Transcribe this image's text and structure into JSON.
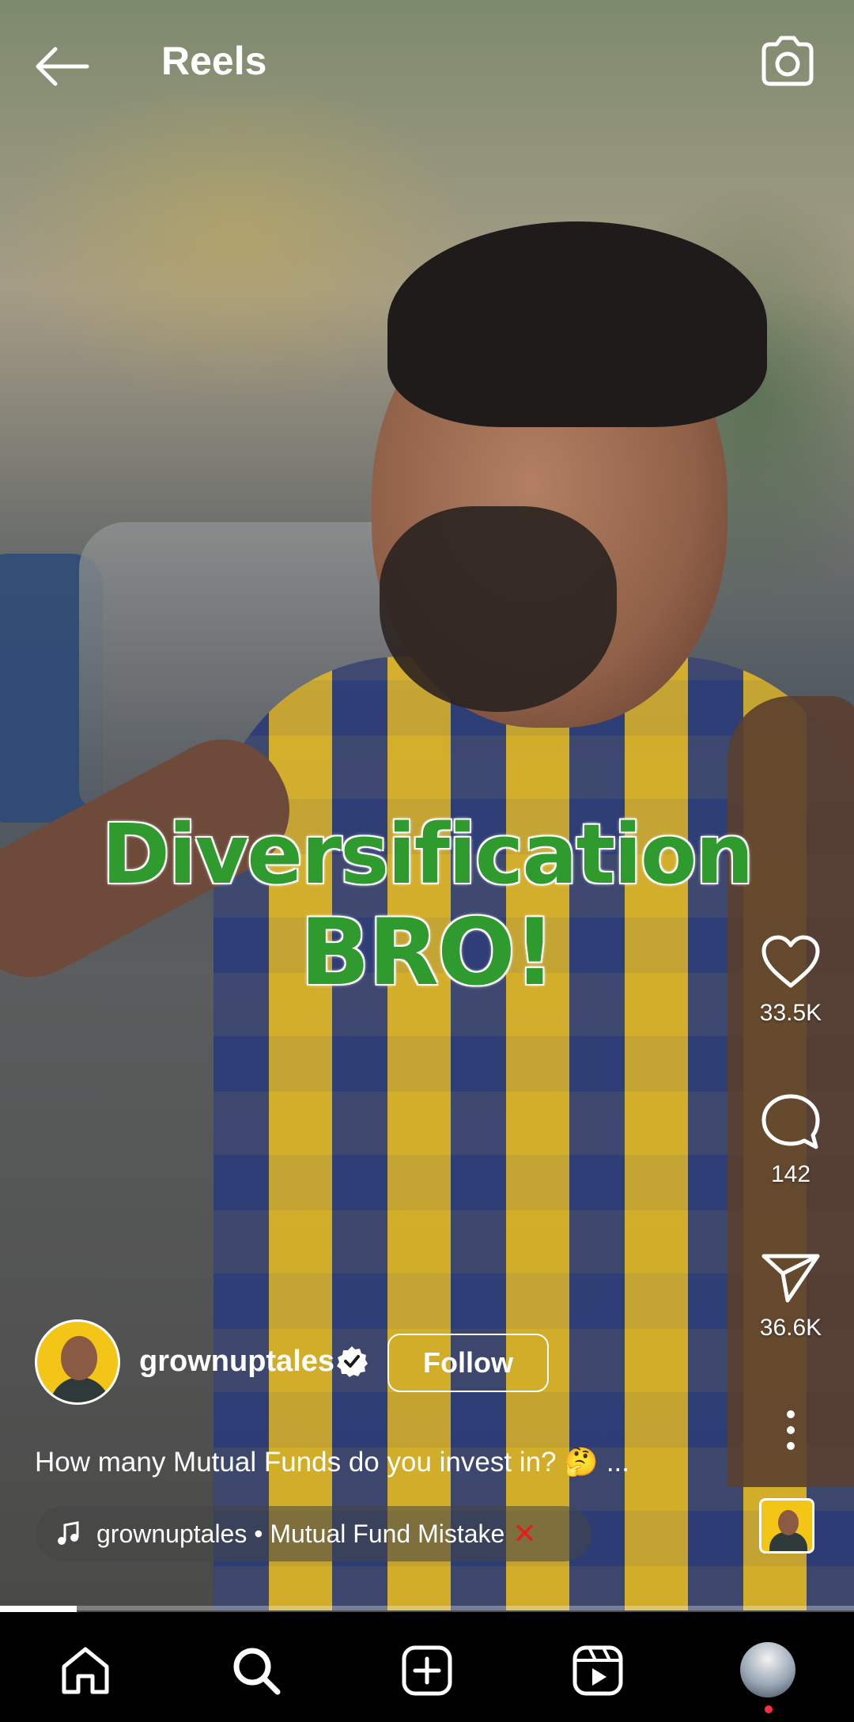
{
  "header": {
    "title": "Reels"
  },
  "video": {
    "overlay_line1": "Diversification",
    "overlay_line2": "BRO!",
    "progress_fraction": 0.09
  },
  "actions": {
    "likes": "33.5K",
    "comments": "142",
    "shares": "36.6K"
  },
  "author": {
    "username": "grownuptales",
    "verified": true,
    "follow_label": "Follow"
  },
  "caption": {
    "text": "How many Mutual Funds do you invest in? 🤔",
    "more": "..."
  },
  "audio": {
    "track": "grownuptales • Mutual Fund Mistake",
    "emoji": "✕"
  },
  "colors": {
    "overlay_green": "#2f9a2d",
    "notification_dot": "#ff2c46",
    "mistake_x": "#e0201c"
  },
  "nav": {
    "items": [
      "home-icon",
      "search-icon",
      "create-icon",
      "reels-icon",
      "profile-avatar"
    ]
  }
}
